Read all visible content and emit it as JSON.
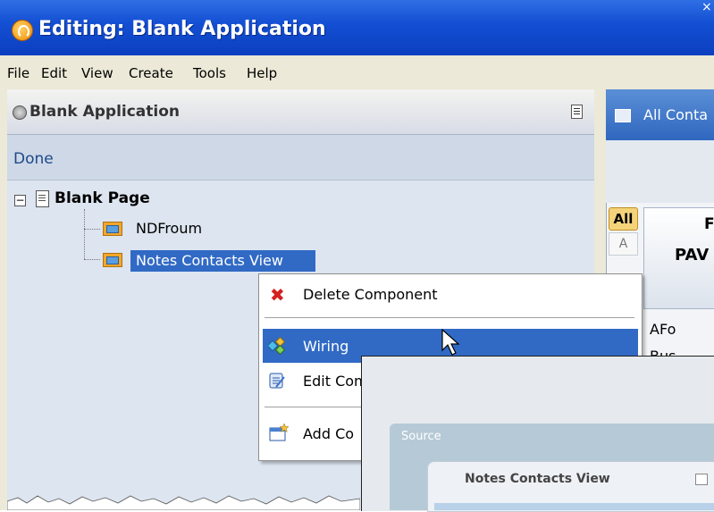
{
  "window": {
    "title": "Editing: Blank Application",
    "close_glyph": "×"
  },
  "menubar": {
    "items": [
      "File",
      "Edit",
      "View",
      "Create",
      "Tools",
      "Help"
    ]
  },
  "left_panel": {
    "title": "Blank Application",
    "done_label": "Done",
    "tree": {
      "root_label": "Blank Page",
      "expander_glyph": "−",
      "items": [
        {
          "label": "NDFroum",
          "selected": false
        },
        {
          "label": "Notes Contacts View",
          "selected": true
        }
      ]
    }
  },
  "context_menu": {
    "items": [
      {
        "label": "Delete Component",
        "icon": "delete-x-icon"
      },
      {
        "label": "Wiring",
        "icon": "wiring-icon",
        "highlighted": true
      },
      {
        "label": "Edit Component Properties",
        "icon": "edit-properties-icon"
      },
      {
        "label": "Add Co",
        "icon": "add-component-icon"
      }
    ]
  },
  "right_panel": {
    "tab_label": "All Conta",
    "alpha_tabs": [
      "All",
      "A"
    ],
    "column_header_line1": "F",
    "column_header_line2": "PAV",
    "cells": [
      "AFo",
      "Bus"
    ]
  },
  "overlay": {
    "source_label": "Source",
    "card_title": "Notes Contacts View"
  },
  "colors": {
    "titlebar": "#1450d4",
    "selection": "#316ac5",
    "menubar": "#ece9d8",
    "panel_bg": "#dde5f0"
  }
}
